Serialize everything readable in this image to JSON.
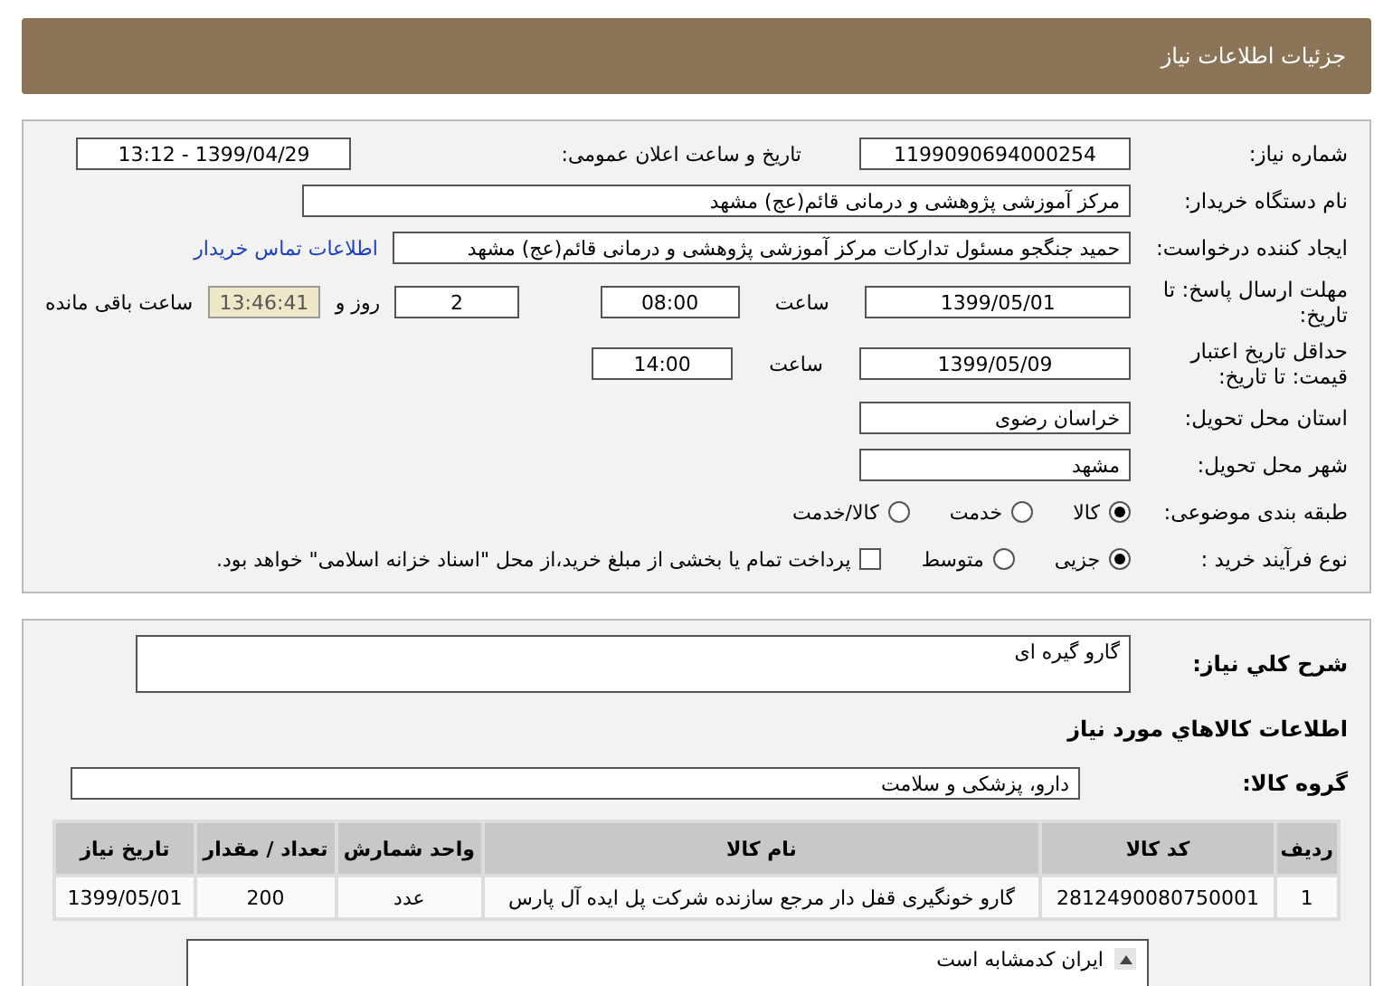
{
  "header": {
    "title": "جزئیات اطلاعات نیاز"
  },
  "details": {
    "need_number": {
      "label": "شماره نیاز:",
      "value": "1199090694000254"
    },
    "announce": {
      "label": "تاریخ و ساعت اعلان عمومی:",
      "value": "1399/04/29 - 13:12"
    },
    "buyer": {
      "label": "نام دستگاه خریدار:",
      "value": "مرکز آموزشی پژوهشی و درمانی قائم(عج) مشهد"
    },
    "creator": {
      "label": "ایجاد کننده درخواست:",
      "value": "حمید جنگجو مسئول تدارکات مرکز آموزشی پژوهشی و درمانی قائم(عج) مشهد",
      "link": "اطلاعات تماس خریدار"
    },
    "deadline": {
      "label": "مهلت ارسال پاسخ: تا تاریخ:",
      "date": "1399/05/01",
      "time_label": "ساعت",
      "time": "08:00",
      "days": "2",
      "days_label": "روز و",
      "remaining": "13:46:41",
      "remaining_label": "ساعت باقی مانده"
    },
    "validity": {
      "label": "حداقل تاریخ اعتبار قیمت: تا تاریخ:",
      "date": "1399/05/09",
      "time_label": "ساعت",
      "time": "14:00"
    },
    "province": {
      "label": "استان محل تحویل:",
      "value": "خراسان رضوی"
    },
    "city": {
      "label": "شهر محل تحویل:",
      "value": "مشهد"
    },
    "category": {
      "label": "طبقه بندی موضوعی:",
      "options": [
        {
          "label": "کالا",
          "selected": true
        },
        {
          "label": "خدمت",
          "selected": false
        },
        {
          "label": "کالا/خدمت",
          "selected": false
        }
      ]
    },
    "process": {
      "label": "نوع فرآیند خرید :",
      "options": [
        {
          "label": "جزیی",
          "selected": true
        },
        {
          "label": "متوسط",
          "selected": false
        }
      ],
      "treasury": {
        "label": "پرداخت تمام یا بخشی از مبلغ خرید،از محل \"اسناد خزانه اسلامی\" خواهد بود.",
        "checked": false
      }
    }
  },
  "need": {
    "description_label": "شرح کلي نیاز:",
    "description": "گارو گیره ای",
    "goods_title": "اطلاعات کالاهاي مورد نیاز",
    "group_label": "گروه کالا:",
    "group": "دارو، پزشکی و سلامت",
    "table": {
      "columns": [
        "ردیف",
        "کد کالا",
        "نام کالا",
        "واحد شمارش",
        "تعداد / مقدار",
        "تاریخ نیاز"
      ],
      "rows": [
        [
          "1",
          "2812490080750001",
          "گارو خونگیری قفل دار مرجع سازنده شرکت پل ایده آل پارس",
          "عدد",
          "200",
          "1399/05/01"
        ]
      ]
    },
    "notes": "ایران کدمشابه است"
  }
}
